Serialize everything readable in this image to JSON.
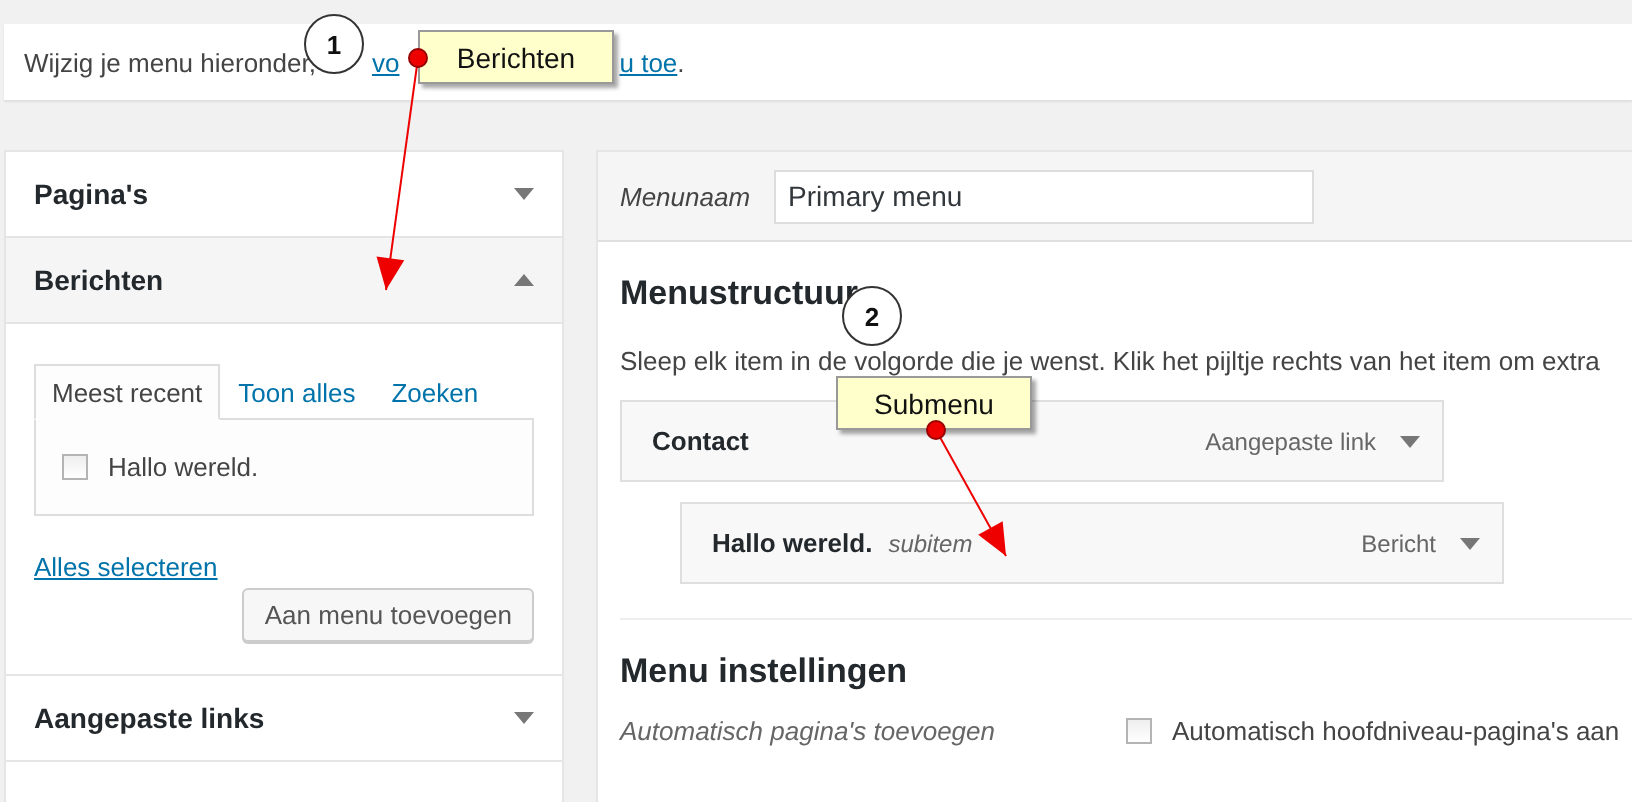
{
  "notice": {
    "text": "Wijzig je menu hieronder,",
    "link_fragments": [
      "vo",
      "u toe"
    ],
    "end": "."
  },
  "callouts": [
    {
      "number": "1",
      "label": "Berichten"
    },
    {
      "number": "2",
      "label": "Submenu"
    }
  ],
  "left_panels": [
    {
      "title": "Pagina's",
      "expanded": false
    },
    {
      "title": "Berichten",
      "expanded": true,
      "tabs": [
        {
          "label": "Meest recent",
          "selected": true
        },
        {
          "label": "Toon alles",
          "selected": false
        },
        {
          "label": "Zoeken",
          "selected": false
        }
      ],
      "items": [
        {
          "label": "Hallo wereld.",
          "checked": false
        }
      ],
      "select_all": "Alles selecteren",
      "add_button": "Aan menu toevoegen"
    },
    {
      "title": "Aangepaste links",
      "expanded": false
    }
  ],
  "menu": {
    "name_label": "Menunaam",
    "name_value": "Primary menu",
    "structure_title": "Menustructuur",
    "instructions": "Sleep elk item in de volgorde die je wenst. Klik het pijltje rechts van het item om extra",
    "items": [
      {
        "title": "Contact",
        "type": "Aangepaste link",
        "children": [
          {
            "title": "Hallo wereld.",
            "note": "subitem",
            "type": "Bericht"
          }
        ]
      }
    ],
    "settings_title": "Menu instellingen",
    "settings": [
      {
        "label": "Automatisch pagina's toevoegen",
        "option": "Automatisch hoofdniveau-pagina's aan",
        "checked": false
      }
    ]
  }
}
